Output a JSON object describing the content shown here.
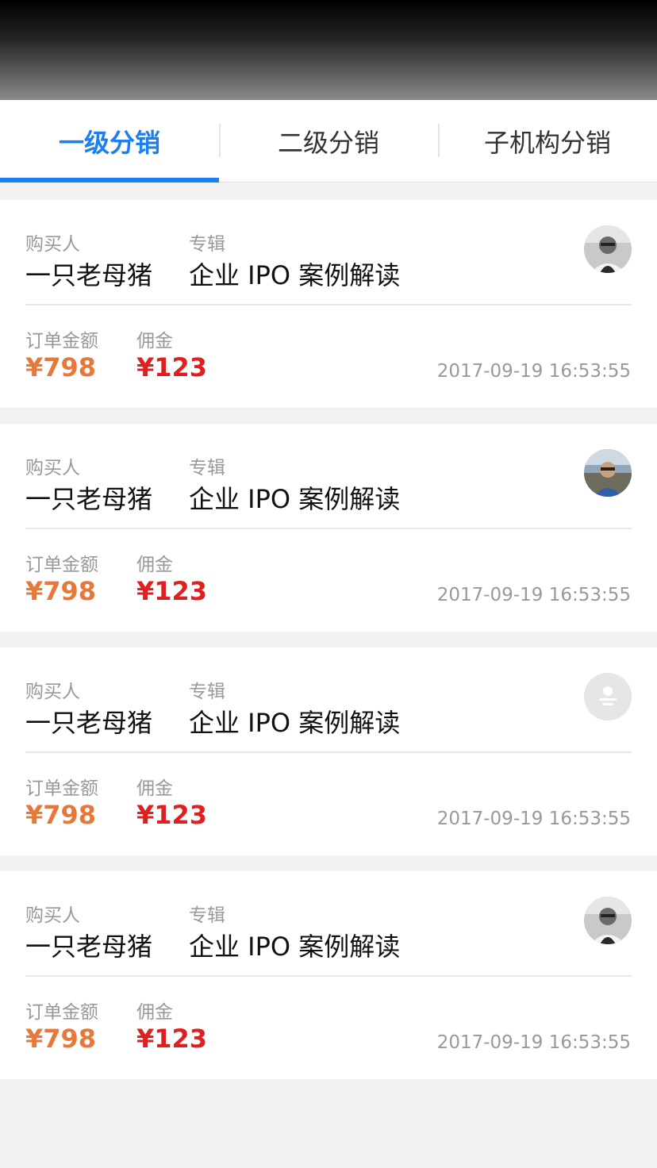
{
  "tabs": [
    {
      "label": "一级分销",
      "active": true
    },
    {
      "label": "二级分销",
      "active": false
    },
    {
      "label": "子机构分销",
      "active": false
    }
  ],
  "labels": {
    "buyer": "购买人",
    "album": "专辑",
    "order_amount": "订单金额",
    "commission": "佣金"
  },
  "colors": {
    "accent": "#1a7ff0",
    "order_amount": "#e8773a",
    "commission": "#e02020"
  },
  "orders": [
    {
      "buyer": "一只老母猪",
      "album": "企业 IPO 案例解读",
      "order_amount": "¥798",
      "commission": "¥123",
      "time": "2017-09-19 16:53:55",
      "avatar": "photo-avatar-grayscale"
    },
    {
      "buyer": "一只老母猪",
      "album": "企业 IPO 案例解读",
      "order_amount": "¥798",
      "commission": "¥123",
      "time": "2017-09-19 16:53:55",
      "avatar": "photo-avatar-color"
    },
    {
      "buyer": "一只老母猪",
      "album": "企业 IPO 案例解读",
      "order_amount": "¥798",
      "commission": "¥123",
      "time": "2017-09-19 16:53:55",
      "avatar": "default-avatar-icon"
    },
    {
      "buyer": "一只老母猪",
      "album": "企业 IPO 案例解读",
      "order_amount": "¥798",
      "commission": "¥123",
      "time": "2017-09-19 16:53:55",
      "avatar": "photo-avatar-grayscale"
    }
  ]
}
